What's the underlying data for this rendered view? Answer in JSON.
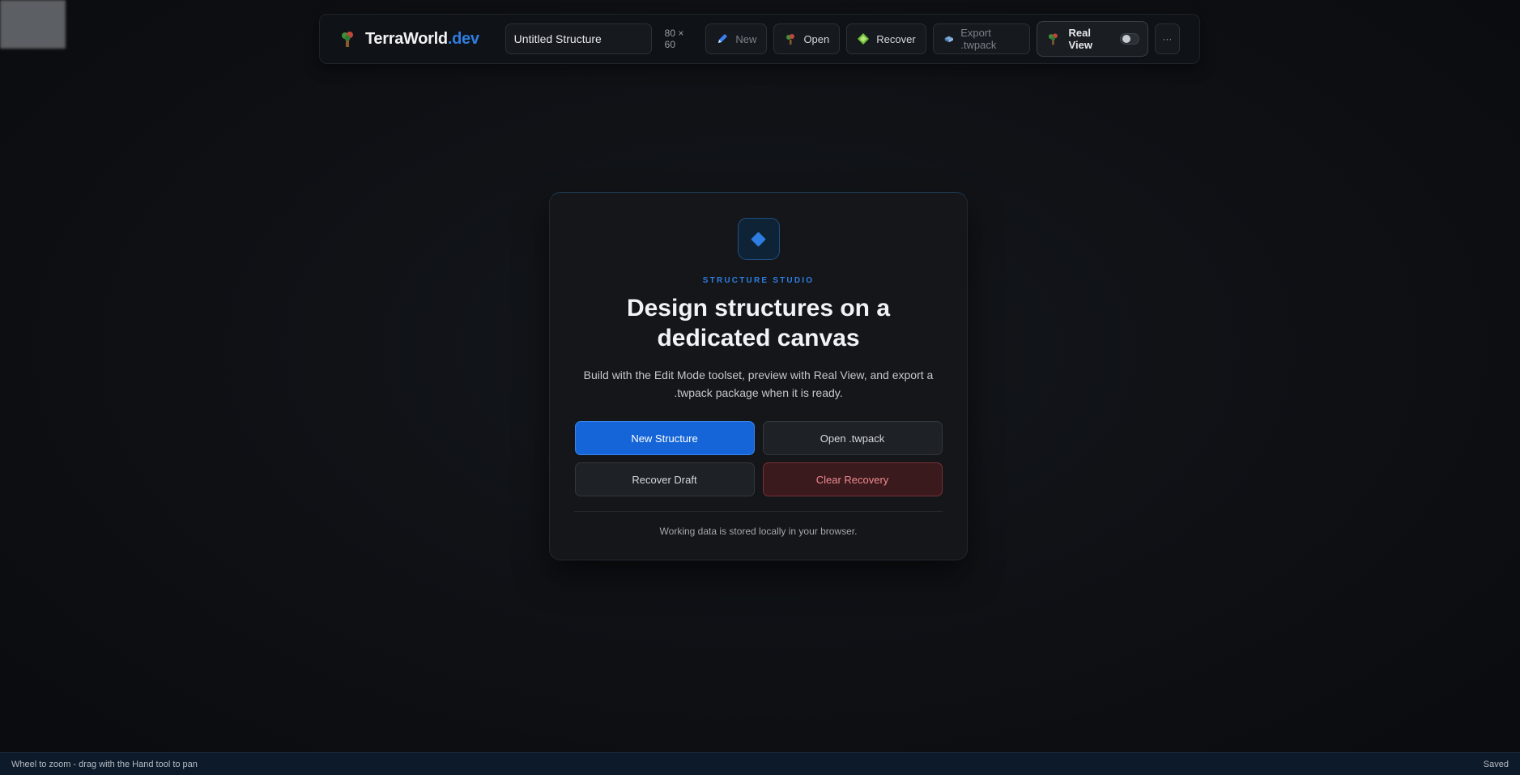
{
  "toolbar": {
    "logo_text": "TerraWorld",
    "logo_accent": ".dev",
    "title_value": "Untitled Structure",
    "dimensions": "80 × 60",
    "new_label": "New",
    "open_label": "Open",
    "recover_label": "Recover",
    "export_label": "Export .twpack",
    "real_view_label": "Real View",
    "more_label": "···"
  },
  "card": {
    "eyebrow": "STRUCTURE STUDIO",
    "headline": "Design structures on a dedicated canvas",
    "description": "Build with the Edit Mode toolset, preview with Real View, and export a .twpack package when it is ready.",
    "buttons": {
      "new_structure": "New Structure",
      "open_twpack": "Open .twpack",
      "recover_draft": "Recover Draft",
      "clear_recovery": "Clear Recovery"
    },
    "footnote": "Working data is stored locally in your browser."
  },
  "statusbar": {
    "hint": "Wheel to zoom - drag with the Hand tool to pan",
    "save_state": "Saved"
  },
  "colors": {
    "accent": "#2f7de0",
    "primary_button": "#1565d8",
    "danger_text": "#f08a92",
    "background": "#0e1014"
  },
  "icons": {
    "logo": "tree-icon",
    "new": "pencil-icon",
    "open": "tree-icon",
    "recover": "diamond-gem-icon",
    "export": "package-icon",
    "real_view": "tree-icon",
    "card": "diamond-icon"
  }
}
